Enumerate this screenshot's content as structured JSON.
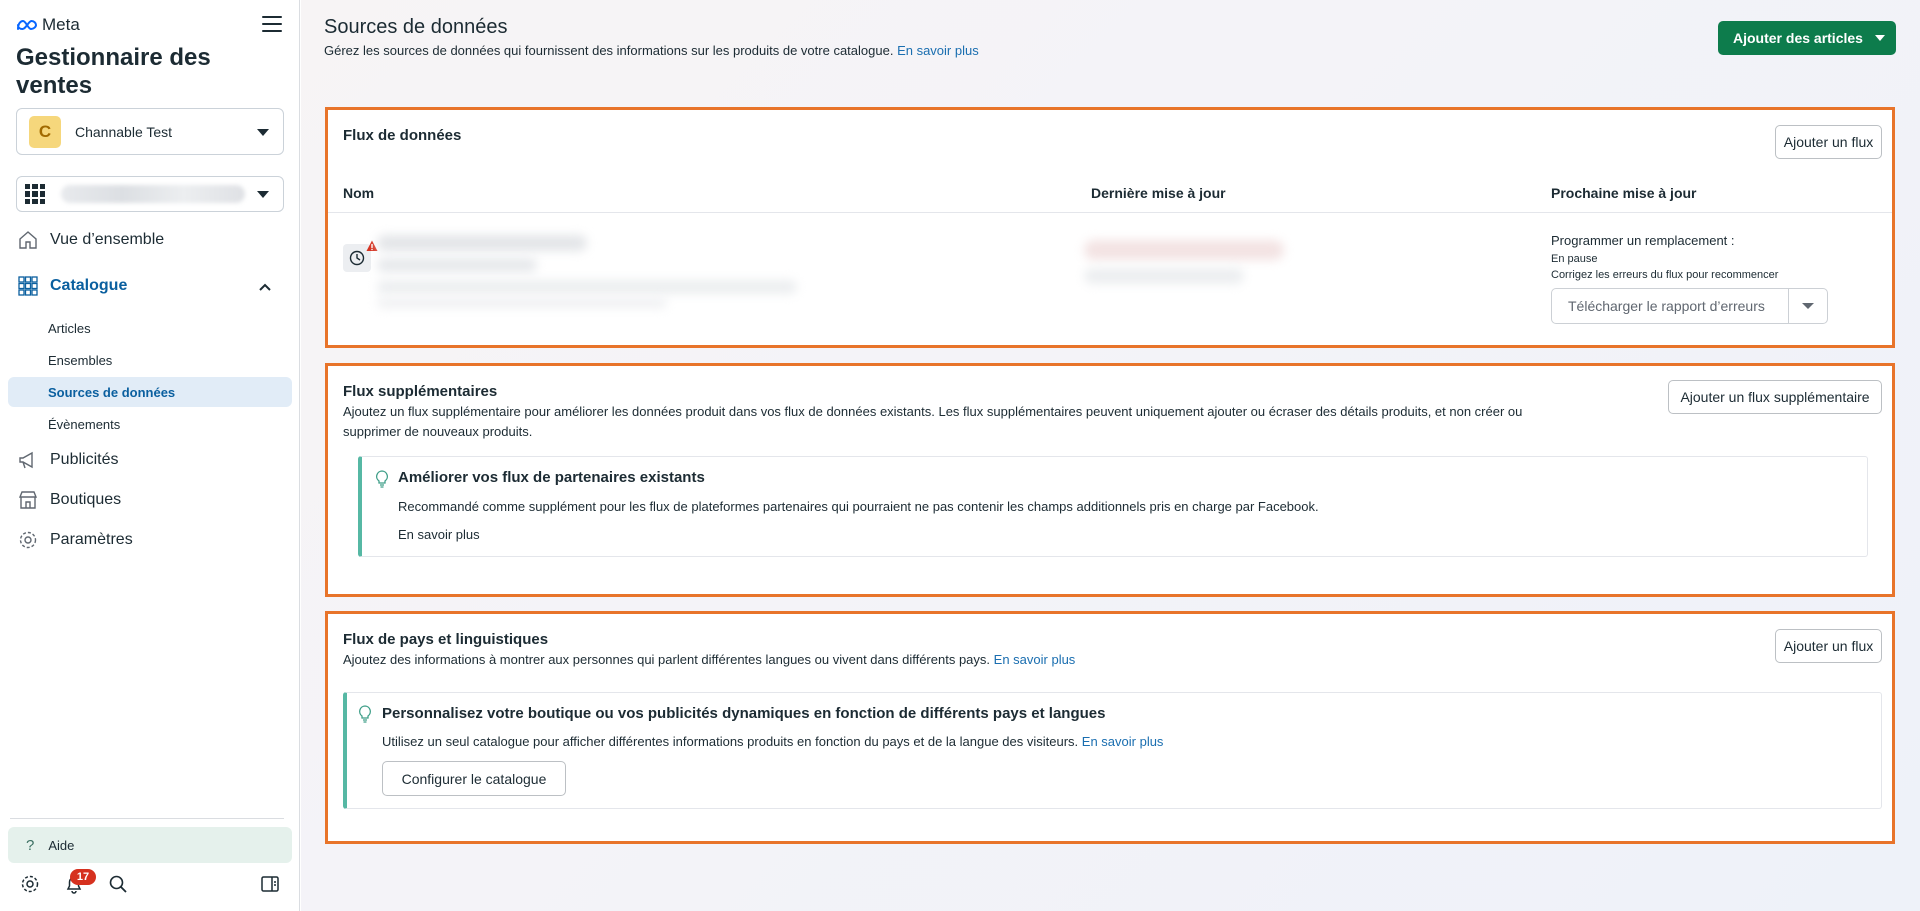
{
  "sidebar": {
    "brand": "Meta",
    "app_title": "Gestionnaire des ventes",
    "business": {
      "initial": "C",
      "name": "Channable Test"
    },
    "nav": {
      "overview": "Vue d’ensemble",
      "catalogue": "Catalogue",
      "sub": [
        "Articles",
        "Ensembles",
        "Sources de données",
        "Évènements"
      ],
      "ads": "Publicités",
      "shops": "Boutiques",
      "settings": "Paramètres"
    },
    "help": "Aide",
    "notification_count": "17"
  },
  "header": {
    "title": "Sources de données",
    "subtitle": "Gérez les sources de données qui fournissent des informations sur les produits de votre catalogue.",
    "learn_more": "En savoir plus",
    "add_items_button": "Ajouter des articles"
  },
  "data_feeds": {
    "title": "Flux de données",
    "add_button": "Ajouter un flux",
    "columns": [
      "Nom",
      "Dernière mise à jour",
      "Prochaine mise à jour"
    ],
    "row": {
      "schedule_title": "Programmer un remplacement :",
      "status": "En pause",
      "hint": "Corrigez les erreurs du flux pour recommencer",
      "download_report": "Télécharger le rapport d’erreurs"
    }
  },
  "supplementary": {
    "title": "Flux supplémentaires",
    "description_line1": "Ajoutez un flux supplémentaire pour améliorer les données produit dans vos flux de données existants. Les flux supplémentaires peuvent uniquement ajouter ou écraser des détails produits, et non créer ou",
    "description_line2": "supprimer de nouveaux produits.",
    "add_button": "Ajouter un flux supplémentaire",
    "tip": {
      "title": "Améliorer vos flux de partenaires existants",
      "text": "Recommandé comme supplément pour les flux de plateformes partenaires qui pourraient ne pas contenir les champs additionnels pris en charge par Facebook.",
      "link": "En savoir plus"
    }
  },
  "country_language": {
    "title": "Flux de pays et linguistiques",
    "description": "Ajoutez des informations à montrer aux personnes qui parlent différentes langues ou vivent dans différents pays.",
    "learn_more": "En savoir plus",
    "add_button": "Ajouter un flux",
    "tip": {
      "title": "Personnalisez votre boutique ou vos publicités dynamiques en fonction de différents pays et langues",
      "text": "Utilisez un seul catalogue pour afficher différentes informations produits en fonction du pays et de la langue des visiteurs.",
      "link": "En savoir plus",
      "configure_button": "Configurer le catalogue"
    }
  },
  "colors": {
    "accent_green": "#0d7c4c",
    "link_blue": "#1a6eb0",
    "highlight_orange": "#e8742a",
    "tip_teal": "#56b8a4"
  }
}
